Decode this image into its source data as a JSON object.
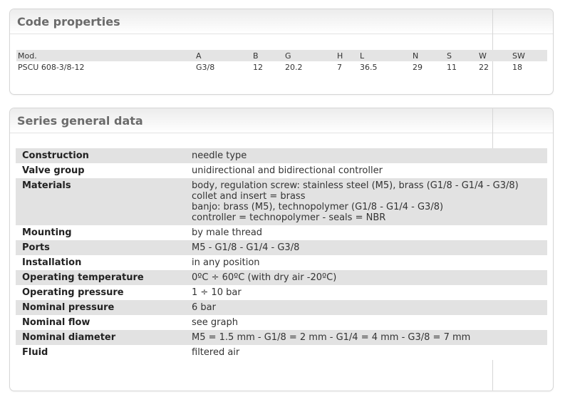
{
  "code_properties": {
    "title": "Code properties",
    "headers": [
      "Mod.",
      "A",
      "B",
      "G",
      "H",
      "L",
      "N",
      "S",
      "W",
      "SW"
    ],
    "row": [
      "PSCU 608-3/8-12",
      "G3/8",
      "12",
      "20.2",
      "7",
      "36.5",
      "29",
      "11",
      "22",
      "18"
    ]
  },
  "series_general_data": {
    "title": "Series general data",
    "rows": [
      {
        "label": "Construction",
        "lines": [
          "needle type"
        ]
      },
      {
        "label": "Valve group",
        "lines": [
          "unidirectional and bidirectional controller"
        ]
      },
      {
        "label": "Materials",
        "lines": [
          "body, regulation screw: stainless steel (M5), brass (G1/8 - G1/4 - G3/8)",
          "collet and insert = brass",
          "banjo: brass (M5), technopolymer (G1/8 - G1/4 - G3/8)",
          "controller = technopolymer - seals = NBR"
        ]
      },
      {
        "label": "Mounting",
        "lines": [
          "by male thread"
        ]
      },
      {
        "label": "Ports",
        "lines": [
          "M5 - G1/8 - G1/4 - G3/8"
        ]
      },
      {
        "label": "Installation",
        "lines": [
          "in any position"
        ]
      },
      {
        "label": "Operating temperature",
        "lines": [
          "0ºC ÷ 60ºC (with dry air -20ºC)"
        ]
      },
      {
        "label": "Operating pressure",
        "lines": [
          "1 ÷ 10 bar"
        ]
      },
      {
        "label": "Nominal pressure",
        "lines": [
          "6 bar"
        ]
      },
      {
        "label": "Nominal flow",
        "lines": [
          "see graph"
        ]
      },
      {
        "label": "Nominal diameter",
        "lines": [
          "M5 = 1.5 mm - G1/8 = 2 mm - G1/4 = 4 mm - G3/8 = 7 mm"
        ]
      },
      {
        "label": "Fluid",
        "lines": [
          "filtered air"
        ]
      }
    ]
  },
  "colors": {
    "header_gradient_top": "#ececec",
    "title_text": "#6b6b6b",
    "row_stripe": "#e2e2e2",
    "border": "#d6d6d6"
  }
}
